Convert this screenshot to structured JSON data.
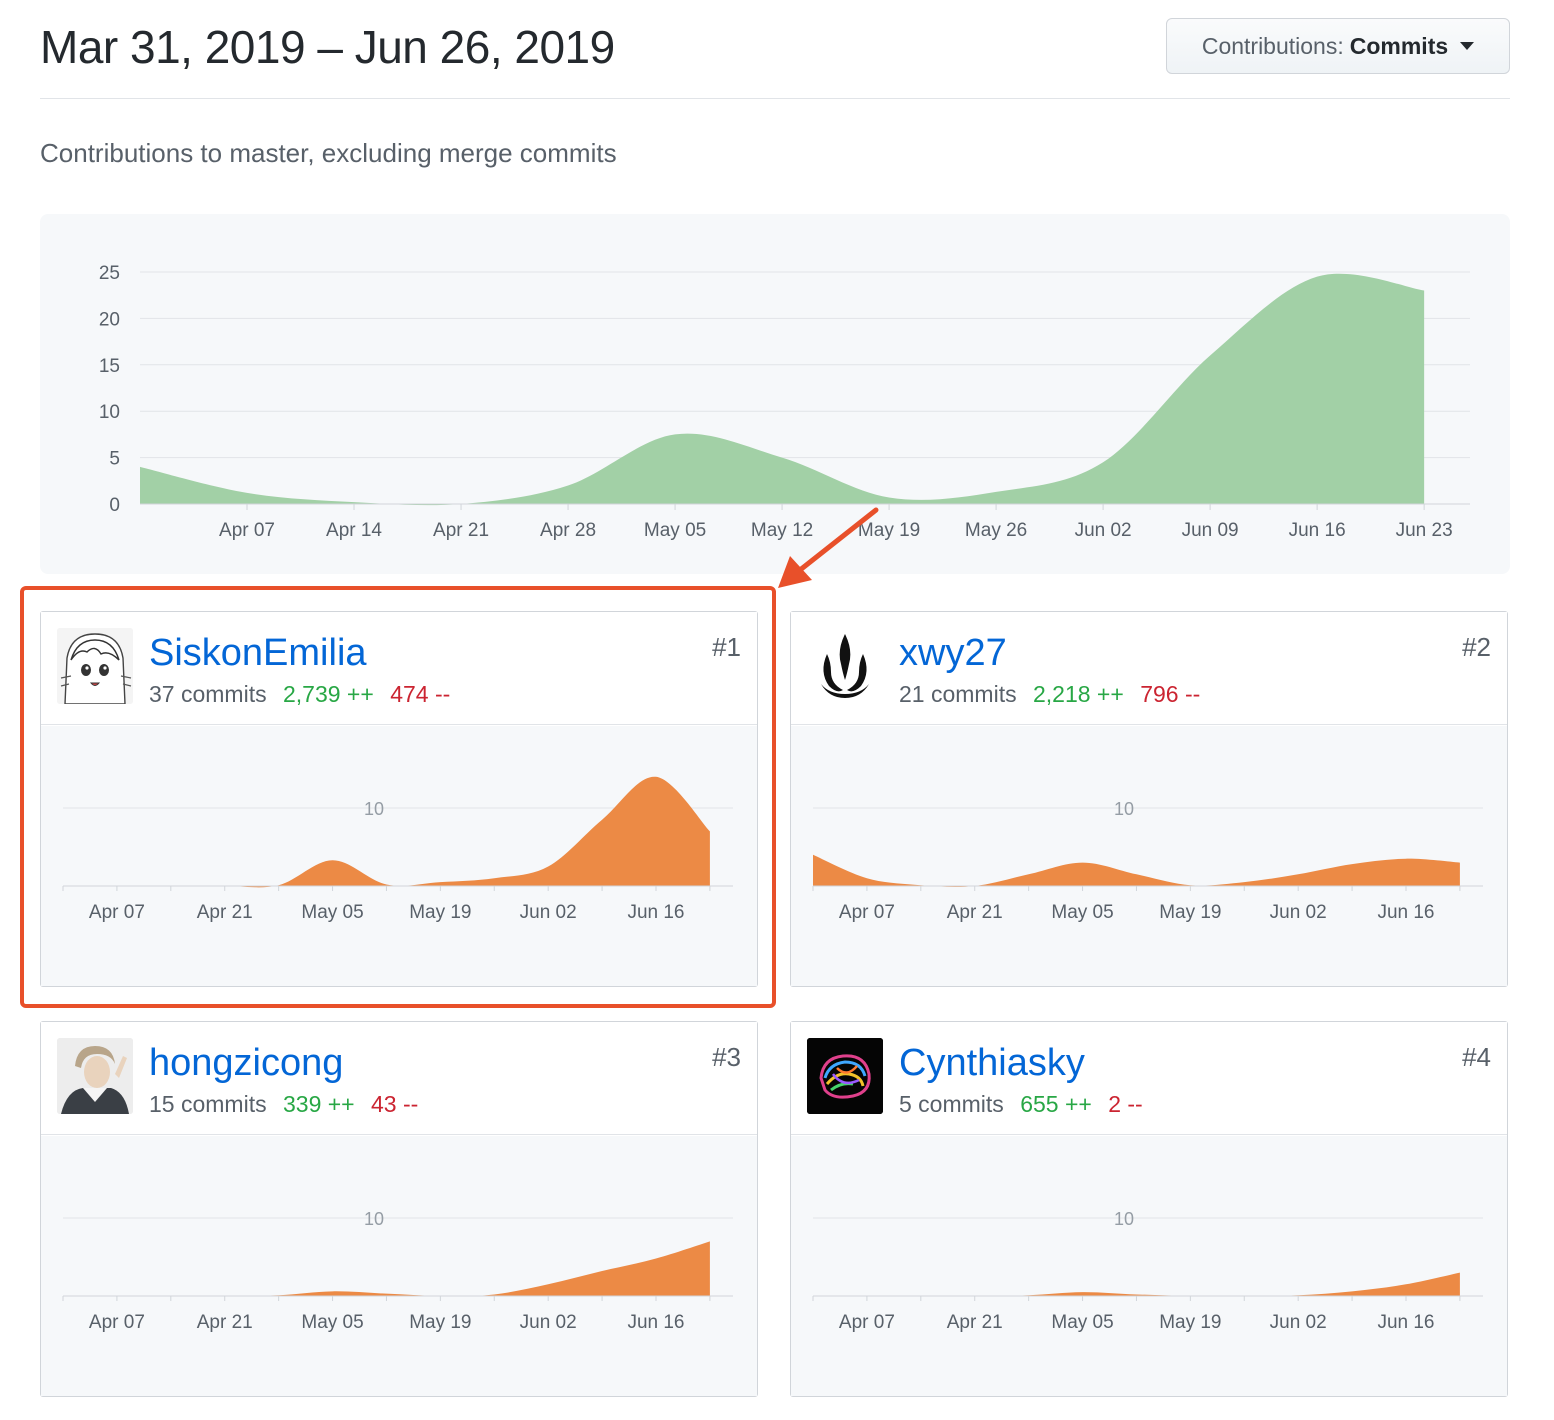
{
  "header": {
    "date_range": "Mar 31, 2019 – Jun 26, 2019",
    "contrib_prefix": "Contributions:",
    "contrib_value": "Commits",
    "subtitle": "Contributions to master, excluding merge commits"
  },
  "colors": {
    "main_fill": "#a2d0a6",
    "user_fill": "#ec8a45",
    "link": "#0366d6",
    "additions": "#28a745",
    "deletions": "#cb2431",
    "highlight": "#e8502a"
  },
  "chart_data": [
    {
      "type": "area",
      "title": "",
      "x_tick_labels": [
        "Apr 07",
        "Apr 14",
        "Apr 21",
        "Apr 28",
        "May 05",
        "May 12",
        "May 19",
        "May 26",
        "Jun 02",
        "Jun 09",
        "Jun 16",
        "Jun 23"
      ],
      "y_tick_labels": [
        "0",
        "5",
        "10",
        "15",
        "20",
        "25"
      ],
      "ylim": [
        0,
        25
      ],
      "grid": true,
      "x": [
        "2019-03-31",
        "2019-04-07",
        "2019-04-14",
        "2019-04-21",
        "2019-04-28",
        "2019-05-05",
        "2019-05-12",
        "2019-05-19",
        "2019-05-26",
        "2019-06-02",
        "2019-06-09",
        "2019-06-16",
        "2019-06-23"
      ],
      "values": [
        4,
        1.2,
        0.2,
        0,
        2,
        7.5,
        5,
        0.7,
        1.3,
        4.5,
        16,
        24.5,
        23
      ]
    }
  ],
  "contributors": [
    {
      "rank": "#1",
      "username": "SiskonEmilia",
      "commits": "37 commits",
      "additions": "2,739 ++",
      "deletions": "474 --",
      "avatar": "anime-girl-avatar",
      "chart": {
        "type": "area",
        "gridline_label": "10",
        "x_tick_labels": [
          "Apr 07",
          "Apr 21",
          "May 05",
          "May 19",
          "Jun 02",
          "Jun 16"
        ],
        "x": [
          "2019-03-31",
          "2019-04-07",
          "2019-04-14",
          "2019-04-21",
          "2019-04-28",
          "2019-05-05",
          "2019-05-12",
          "2019-05-19",
          "2019-05-26",
          "2019-06-02",
          "2019-06-09",
          "2019-06-16",
          "2019-06-23"
        ],
        "values": [
          0,
          0,
          0,
          0,
          0.1,
          3.3,
          0.2,
          0.5,
          1,
          2.5,
          8.5,
          14,
          7
        ]
      }
    },
    {
      "rank": "#2",
      "username": "xwy27",
      "commits": "21 commits",
      "additions": "2,218 ++",
      "deletions": "796 --",
      "avatar": "flame-logo-avatar",
      "chart": {
        "type": "area",
        "gridline_label": "10",
        "x_tick_labels": [
          "Apr 07",
          "Apr 21",
          "May 05",
          "May 19",
          "Jun 02",
          "Jun 16"
        ],
        "x": [
          "2019-03-31",
          "2019-04-07",
          "2019-04-14",
          "2019-04-21",
          "2019-04-28",
          "2019-05-05",
          "2019-05-12",
          "2019-05-19",
          "2019-05-26",
          "2019-06-02",
          "2019-06-09",
          "2019-06-16",
          "2019-06-23"
        ],
        "values": [
          4,
          1,
          0.1,
          0,
          1.5,
          3,
          1.5,
          0.1,
          0.5,
          1.5,
          2.8,
          3.5,
          3
        ]
      }
    },
    {
      "rank": "#3",
      "username": "hongzicong",
      "commits": "15 commits",
      "additions": "339 ++",
      "deletions": "43 --",
      "avatar": "person-photo-avatar",
      "chart": {
        "type": "area",
        "gridline_label": "10",
        "x_tick_labels": [
          "Apr 07",
          "Apr 21",
          "May 05",
          "May 19",
          "Jun 02",
          "Jun 16"
        ],
        "x": [
          "2019-03-31",
          "2019-04-07",
          "2019-04-14",
          "2019-04-21",
          "2019-04-28",
          "2019-05-05",
          "2019-05-12",
          "2019-05-19",
          "2019-05-26",
          "2019-06-02",
          "2019-06-09",
          "2019-06-16",
          "2019-06-23"
        ],
        "values": [
          0,
          0,
          0,
          0,
          0.1,
          0.6,
          0.3,
          0,
          0.2,
          1.5,
          3.2,
          4.8,
          7
        ]
      }
    },
    {
      "rank": "#4",
      "username": "Cynthiasky",
      "commits": "5 commits",
      "additions": "655 ++",
      "deletions": "2 --",
      "avatar": "colorful-brain-avatar",
      "chart": {
        "type": "area",
        "gridline_label": "10",
        "x_tick_labels": [
          "Apr 07",
          "Apr 21",
          "May 05",
          "May 19",
          "Jun 02",
          "Jun 16"
        ],
        "x": [
          "2019-03-31",
          "2019-04-07",
          "2019-04-14",
          "2019-04-21",
          "2019-04-28",
          "2019-05-05",
          "2019-05-12",
          "2019-05-19",
          "2019-05-26",
          "2019-06-02",
          "2019-06-09",
          "2019-06-16",
          "2019-06-23"
        ],
        "values": [
          0,
          0,
          0,
          0,
          0.1,
          0.5,
          0.2,
          0,
          0,
          0.1,
          0.6,
          1.5,
          3
        ]
      }
    }
  ]
}
